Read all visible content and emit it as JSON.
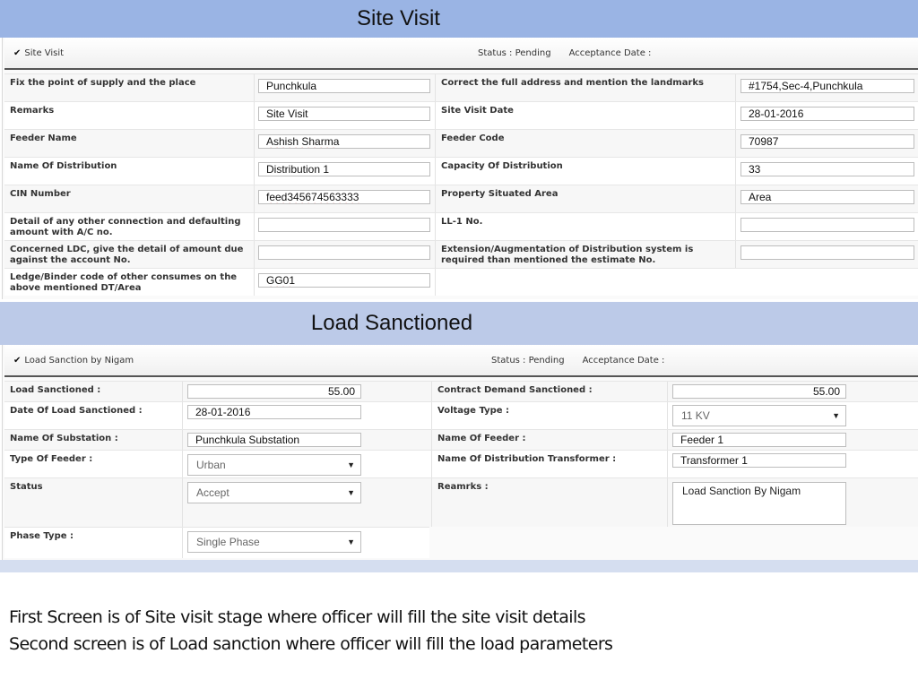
{
  "site_visit_banner": "Site Visit",
  "site_visit": {
    "panel_title": "Site Visit",
    "status_label": "Status",
    "status_sep": " : ",
    "status_value": "Pending",
    "acceptance_label": "Acceptance Date :",
    "left_fields": [
      {
        "label": "Fix the point of supply and the place",
        "value": "Punchkula"
      },
      {
        "label": "Remarks",
        "value": "Site Visit"
      },
      {
        "label": "Feeder Name",
        "value": "Ashish Sharma"
      },
      {
        "label": "Name Of Distribution",
        "value": "Distribution 1"
      },
      {
        "label": "CIN Number",
        "value": "feed345674563333"
      },
      {
        "label": "Detail of any other connection and defaulting amount with A/C no.",
        "value": ""
      },
      {
        "label": "Concerned LDC, give the detail of amount due against the account No.",
        "value": ""
      },
      {
        "label": "Ledge/Binder code of other consumes on the above mentioned DT/Area",
        "value": "GG01"
      }
    ],
    "right_fields": [
      {
        "label": "Correct the full address and mention the landmarks",
        "value": "#1754,Sec-4,Punchkula"
      },
      {
        "label": "Site Visit Date",
        "value": "28-01-2016"
      },
      {
        "label": "Feeder Code",
        "value": "70987"
      },
      {
        "label": "Capacity Of Distribution",
        "value": "33"
      },
      {
        "label": "Property Situated Area",
        "value": "Area"
      },
      {
        "label": "LL-1 No.",
        "value": ""
      },
      {
        "label": "Extension/Augmentation of Distribution system is required than mentioned the estimate No.",
        "value": ""
      }
    ]
  },
  "load_banner": "Load Sanctioned",
  "load_sanction": {
    "panel_title": "Load Sanction by Nigam",
    "status_label": "Status",
    "status_sep": " : ",
    "status_value": "Pending",
    "acceptance_label": "Acceptance Date :",
    "load_sanctioned": {
      "label": "Load Sanctioned :",
      "value": "55.00"
    },
    "contract_demand": {
      "label": "Contract Demand Sanctioned :",
      "value": "55.00"
    },
    "date_load": {
      "label": "Date Of Load Sanctioned :",
      "value": "28-01-2016"
    },
    "voltage_type": {
      "label": "Voltage Type :",
      "value": "11 KV"
    },
    "substation": {
      "label": "Name Of Substation :",
      "value": "Punchkula Substation"
    },
    "feeder_name": {
      "label": "Name Of Feeder :",
      "value": "Feeder 1"
    },
    "feeder_type": {
      "label": "Type Of Feeder :",
      "value": "Urban"
    },
    "transformer": {
      "label": "Name Of Distribution Transformer :",
      "value": "Transformer 1"
    },
    "status": {
      "label": "Status",
      "value": "Accept"
    },
    "remarks": {
      "label": "Reamrks :",
      "value": "Load Sanction By Nigam"
    },
    "phase_type": {
      "label": "Phase Type :",
      "value": "Single Phase"
    }
  },
  "captions": [
    "First Screen is of Site visit stage where officer will fill the site visit details",
    "Second screen is of Load sanction where officer will fill the load parameters"
  ],
  "icons": {
    "chevron": "chevron-down-icon",
    "dropdown": "dropdown-arrow-icon"
  }
}
